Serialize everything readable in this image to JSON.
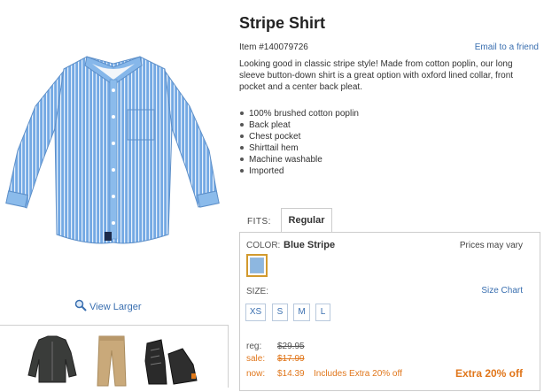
{
  "product": {
    "title": "Stripe Shirt",
    "item_number": "Item #140079726",
    "email_link": "Email to a friend",
    "description": "Looking good in classic stripe style! Made from cotton poplin, our long sleeve button-down shirt is a great option with oxford lined collar, front pocket and a center back pleat.",
    "features": [
      "100% brushed cotton poplin",
      "Back pleat",
      "Chest pocket",
      "Shirttail hem",
      "Machine washable",
      "Imported"
    ]
  },
  "image": {
    "view_larger": "View Larger"
  },
  "fits": {
    "label": "FITS:",
    "tab": "Regular"
  },
  "color": {
    "label": "COLOR:",
    "value": "Blue Stripe",
    "prices_note": "Prices may vary",
    "swatch_hex": "#8db7e0"
  },
  "size": {
    "label": "SIZE:",
    "chart_link": "Size Chart",
    "options": [
      "XS",
      "S",
      "M",
      "L"
    ]
  },
  "pricing": {
    "reg_label": "reg:",
    "reg_price": "$29.95",
    "sale_label": "sale:",
    "sale_price": "$17.99",
    "now_label": "now:",
    "now_price": "$14.39",
    "now_extra": "Includes Extra 20% off",
    "promo": "Extra 20% off"
  },
  "colors": {
    "link": "#3a6fb0",
    "accent": "#e0761b",
    "shirt": "#7fb0e6"
  },
  "icons": {
    "view_larger": "magnifier-icon"
  }
}
